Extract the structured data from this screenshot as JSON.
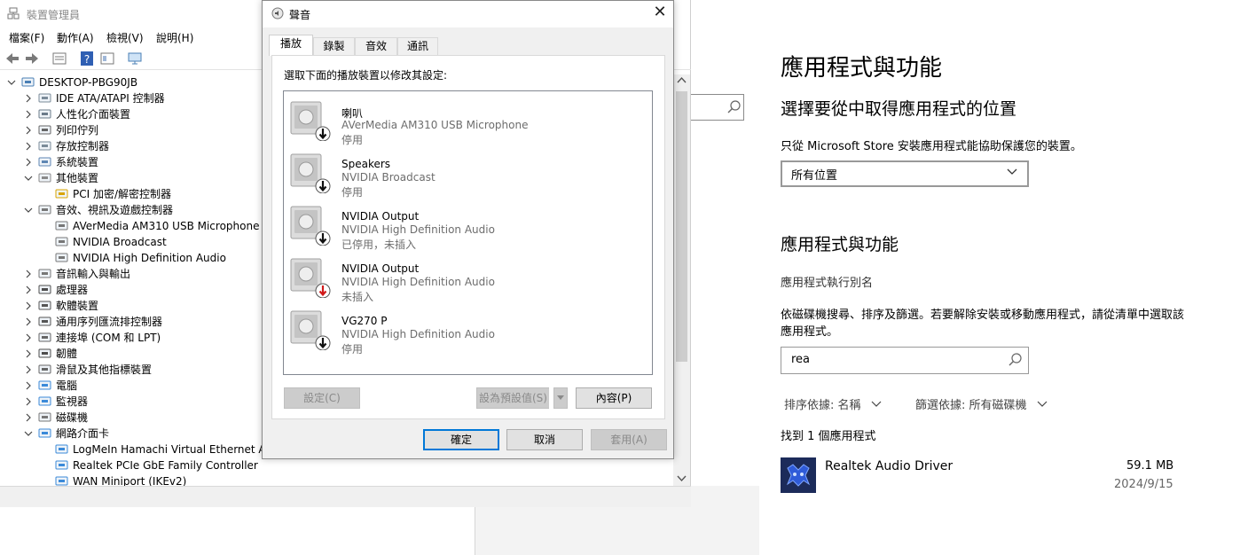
{
  "device_manager": {
    "title": "裝置管理員",
    "menu": [
      "檔案(F)",
      "動作(A)",
      "檢視(V)",
      "說明(H)"
    ],
    "tree": [
      {
        "label": "DESKTOP-PBG90JB",
        "indent": 0,
        "exp": "v",
        "icon": "computer-icon"
      },
      {
        "label": "IDE ATA/ATAPI 控制器",
        "indent": 1,
        "exp": ">",
        "icon": "ide-controller-icon"
      },
      {
        "label": "人性化介面裝置",
        "indent": 1,
        "exp": ">",
        "icon": "hid-icon"
      },
      {
        "label": "列印佇列",
        "indent": 1,
        "exp": ">",
        "icon": "printer-icon"
      },
      {
        "label": "存放控制器",
        "indent": 1,
        "exp": ">",
        "icon": "storage-controller-icon"
      },
      {
        "label": "系統裝置",
        "indent": 1,
        "exp": ">",
        "icon": "system-devices-icon"
      },
      {
        "label": "其他裝置",
        "indent": 1,
        "exp": "v",
        "icon": "other-devices-icon"
      },
      {
        "label": "PCI 加密/解密控制器",
        "indent": 2,
        "exp": "",
        "icon": "warning-device-icon"
      },
      {
        "label": "音效、視訊及遊戲控制器",
        "indent": 1,
        "exp": "v",
        "icon": "speaker-icon"
      },
      {
        "label": "AVerMedia AM310 USB Microphone",
        "indent": 2,
        "exp": "",
        "icon": "speaker-icon"
      },
      {
        "label": "NVIDIA Broadcast",
        "indent": 2,
        "exp": "",
        "icon": "speaker-icon"
      },
      {
        "label": "NVIDIA High Definition Audio",
        "indent": 2,
        "exp": "",
        "icon": "speaker-icon"
      },
      {
        "label": "音訊輸入與輸出",
        "indent": 1,
        "exp": ">",
        "icon": "audio-io-icon"
      },
      {
        "label": "處理器",
        "indent": 1,
        "exp": ">",
        "icon": "processor-icon"
      },
      {
        "label": "軟體裝置",
        "indent": 1,
        "exp": ">",
        "icon": "software-device-icon"
      },
      {
        "label": "通用序列匯流排控制器",
        "indent": 1,
        "exp": ">",
        "icon": "usb-icon"
      },
      {
        "label": "連接埠 (COM 和 LPT)",
        "indent": 1,
        "exp": ">",
        "icon": "port-icon"
      },
      {
        "label": "韌體",
        "indent": 1,
        "exp": ">",
        "icon": "firmware-icon"
      },
      {
        "label": "滑鼠及其他指標裝置",
        "indent": 1,
        "exp": ">",
        "icon": "mouse-icon"
      },
      {
        "label": "電腦",
        "indent": 1,
        "exp": ">",
        "icon": "monitor-icon"
      },
      {
        "label": "監視器",
        "indent": 1,
        "exp": ">",
        "icon": "monitor-icon"
      },
      {
        "label": "磁碟機",
        "indent": 1,
        "exp": ">",
        "icon": "disk-drive-icon"
      },
      {
        "label": "網路介面卡",
        "indent": 1,
        "exp": "v",
        "icon": "network-icon"
      },
      {
        "label": "LogMeIn Hamachi Virtual Ethernet Adapter",
        "indent": 2,
        "exp": "",
        "icon": "network-adapter-icon"
      },
      {
        "label": "Realtek PCIe GbE Family Controller",
        "indent": 2,
        "exp": "",
        "icon": "network-adapter-icon"
      },
      {
        "label": "WAN Miniport (IKEv2)",
        "indent": 2,
        "exp": "",
        "icon": "network-adapter-icon"
      }
    ]
  },
  "sound_dialog": {
    "title": "聲音",
    "close_glyph": "✕",
    "tabs": [
      "播放",
      "錄製",
      "音效",
      "通訊"
    ],
    "instruction": "選取下面的播放裝置以修改其設定:",
    "devices": [
      {
        "name": "喇叭",
        "driver": "AVerMedia AM310 USB Microphone",
        "status": "停用",
        "arrow": "black"
      },
      {
        "name": "Speakers",
        "driver": "NVIDIA Broadcast",
        "status": "停用",
        "arrow": "black"
      },
      {
        "name": "NVIDIA Output",
        "driver": "NVIDIA High Definition Audio",
        "status": "已停用，未插入",
        "arrow": "black"
      },
      {
        "name": "NVIDIA Output",
        "driver": "NVIDIA High Definition Audio",
        "status": "未插入",
        "arrow": "red"
      },
      {
        "name": "VG270 P",
        "driver": "NVIDIA High Definition Audio",
        "status": "停用",
        "arrow": "black"
      }
    ],
    "buttons": {
      "configure": "設定(C)",
      "set_default": "設為預設值(S)",
      "properties": "內容(P)",
      "ok": "確定",
      "cancel": "取消",
      "apply": "套用(A)"
    }
  },
  "settings": {
    "heading": "應用程式與功能",
    "choose_heading": "選擇要從中取得應用程式的位置",
    "store_desc": "只從 Microsoft Store 安裝應用程式能協助保護您的裝置。",
    "location_value": "所有位置",
    "apps_heading": "應用程式與功能",
    "alias_link": "應用程式執行別名",
    "search_desc": "依磁碟機搜尋、排序及篩選。若要解除安裝或移動應用程式，請從清單中選取該應用程式。",
    "search_value": "rea",
    "sort_label": "排序依據: 名稱",
    "filter_label": "篩選依據: 所有磁碟機",
    "found_text": "找到 1 個應用程式",
    "app": {
      "name": "Realtek Audio Driver",
      "size": "59.1 MB",
      "date": "2024/9/15"
    }
  }
}
